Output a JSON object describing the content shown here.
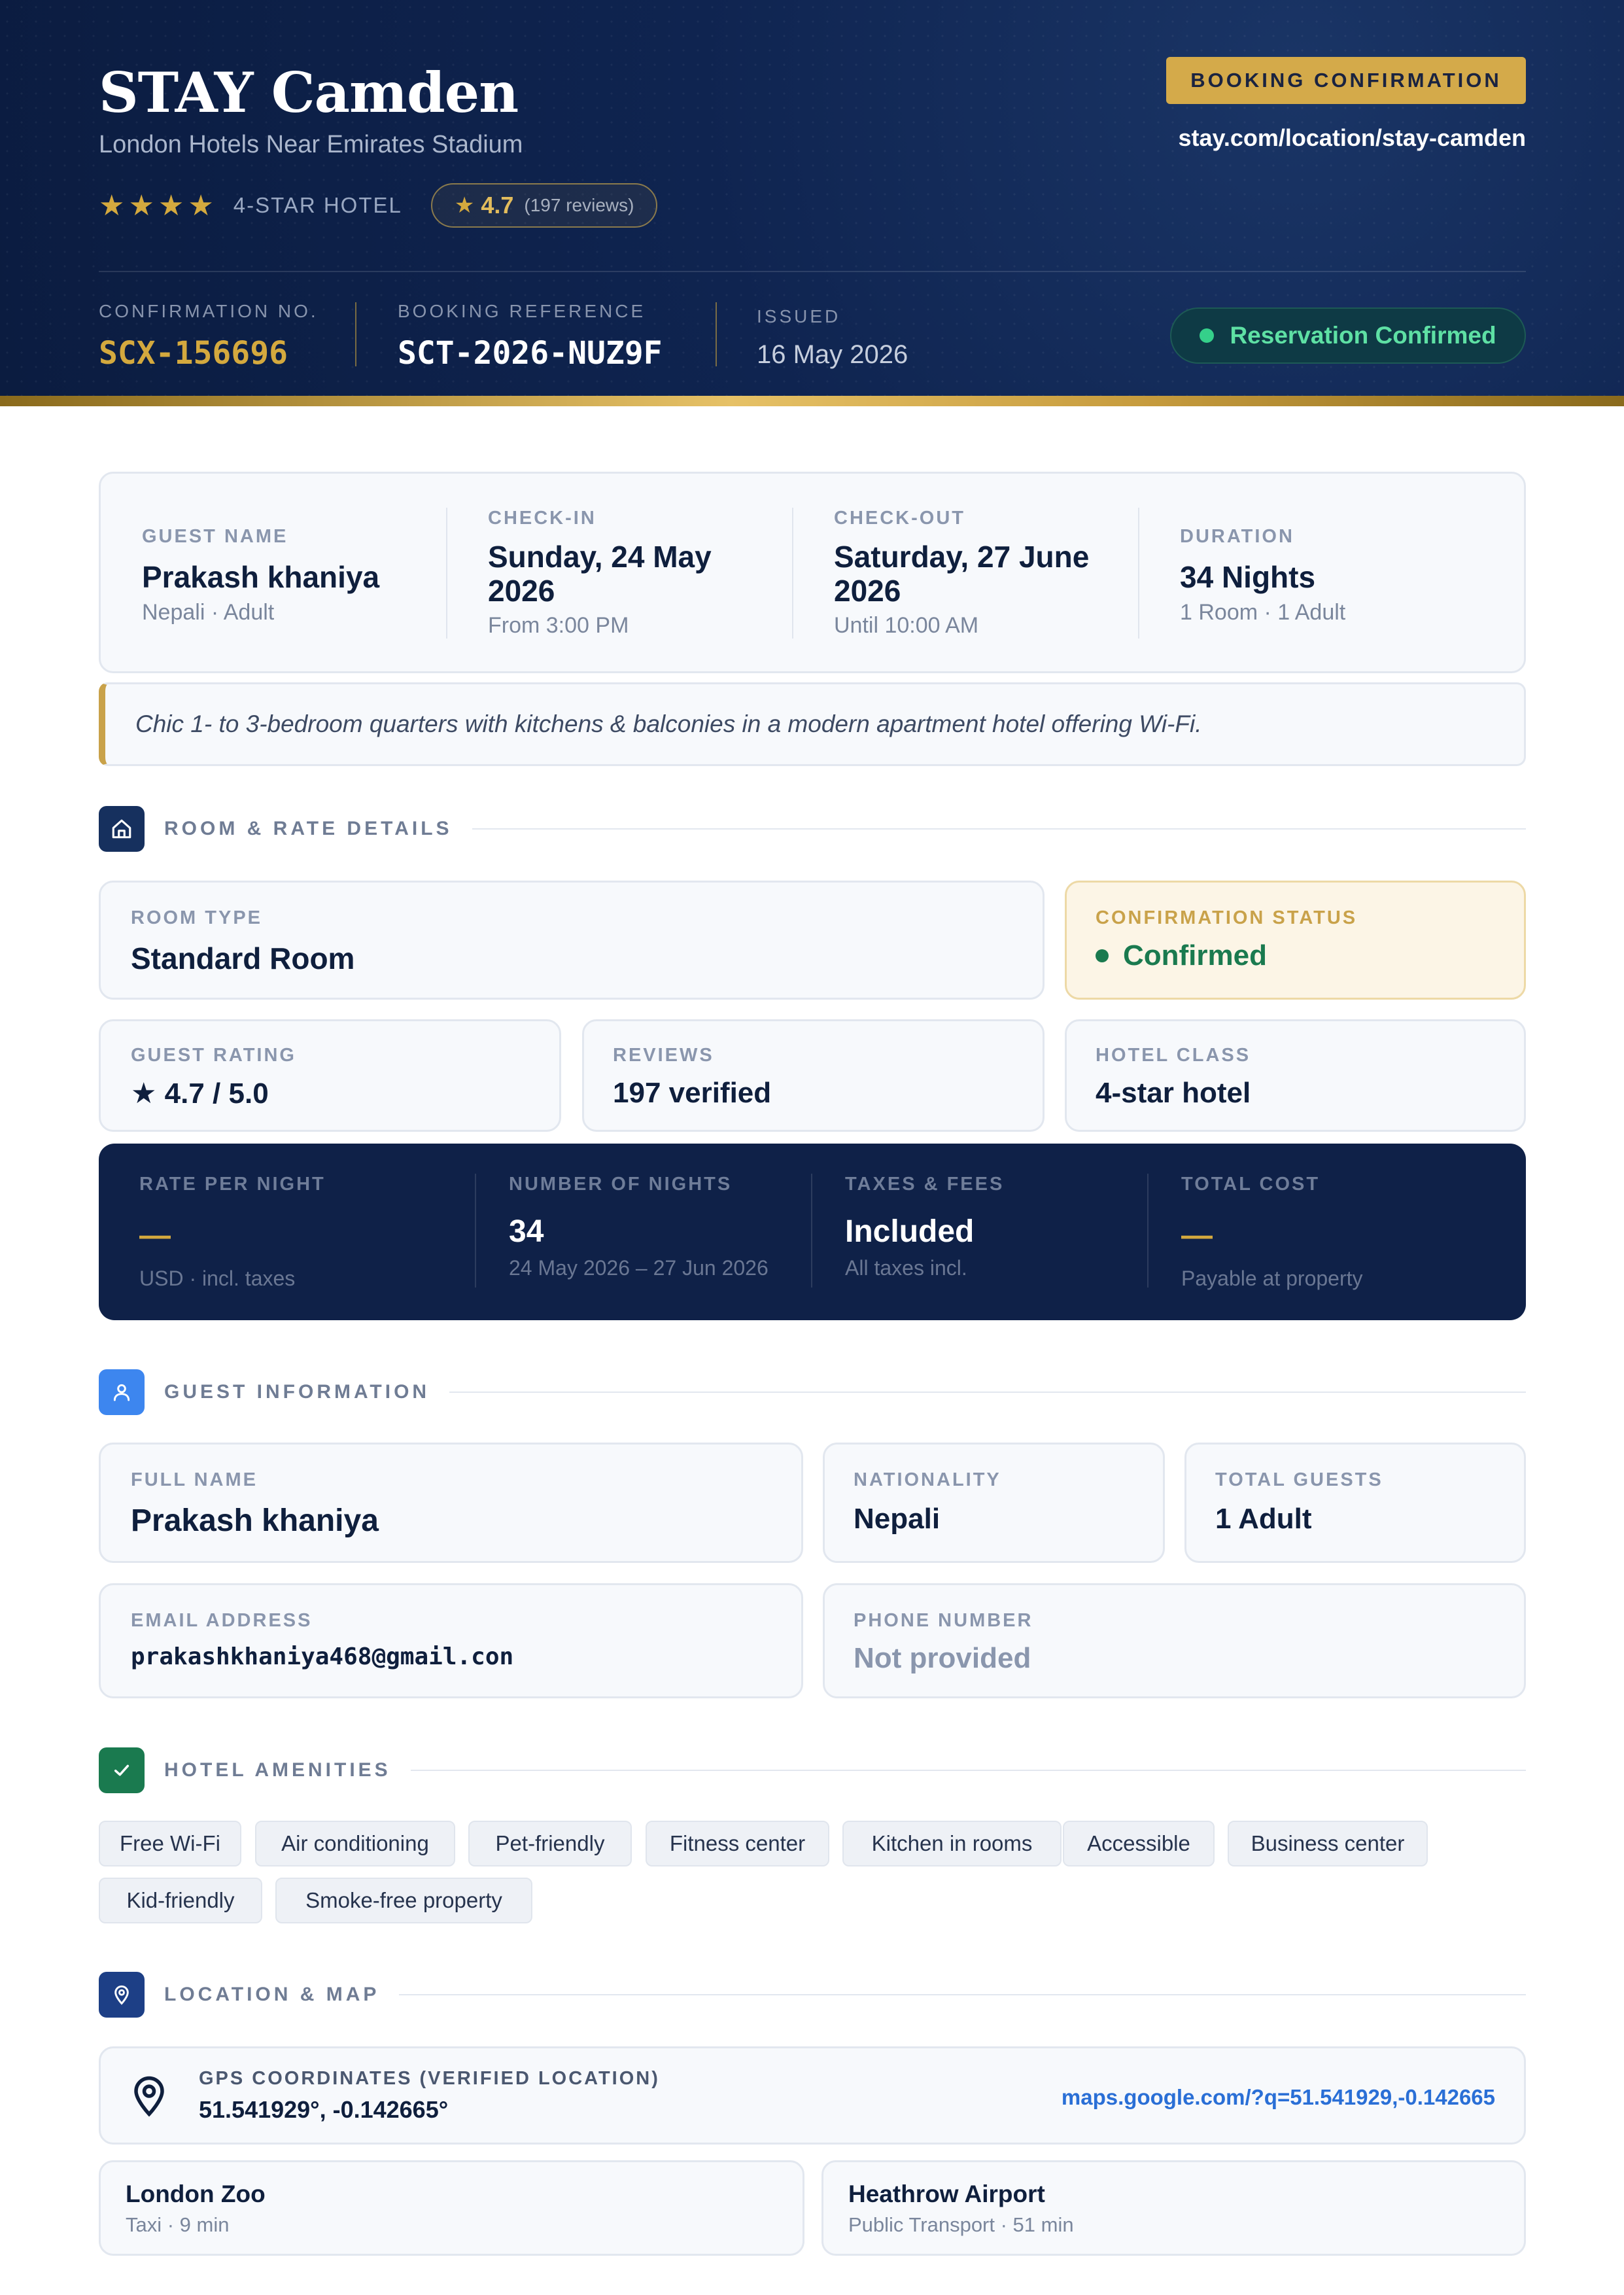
{
  "header": {
    "hotel_name": "STAY Camden",
    "subtitle": "London Hotels Near Emirates Stadium",
    "stars": "★★★★",
    "hotel_class": "4-STAR HOTEL",
    "rating_star": "★",
    "rating_value": "4.7",
    "rating_reviews": "(197 reviews)",
    "badge": "BOOKING CONFIRMATION",
    "url": "stay.com/location/stay-camden",
    "confirmation_label": "CONFIRMATION NO.",
    "confirmation_no": "SCX-156696",
    "booking_ref_label": "BOOKING REFERENCE",
    "booking_ref": "SCT-2026-NUZ9F",
    "issued_label": "ISSUED",
    "issued": "16 May 2026",
    "status": "Reservation Confirmed"
  },
  "summary": {
    "guest_label": "GUEST NAME",
    "guest_name": "Prakash khaniya",
    "guest_sub": "Nepali · Adult",
    "checkin_label": "CHECK-IN",
    "checkin_line1": "Sunday, 24 May",
    "checkin_line2": "2026",
    "checkin_sub": "From 3:00 PM",
    "checkout_label": "CHECK-OUT",
    "checkout_line1": "Saturday, 27 June",
    "checkout_line2": "2026",
    "checkout_sub": "Until 10:00 AM",
    "duration_label": "DURATION",
    "duration": "34 Nights",
    "duration_sub": "1 Room · 1 Adult"
  },
  "description": "Chic 1- to 3-bedroom quarters with kitchens & balconies in a modern apartment hotel offering Wi-Fi.",
  "room": {
    "section_title": "ROOM & RATE DETAILS",
    "room_type_label": "ROOM TYPE",
    "room_type": "Standard Room",
    "conf_status_label": "CONFIRMATION STATUS",
    "conf_status": "Confirmed",
    "guest_rating_label": "GUEST RATING",
    "guest_rating": "★ 4.7 / 5.0",
    "reviews_label": "REVIEWS",
    "reviews": "197 verified",
    "hotel_class_label": "HOTEL CLASS",
    "hotel_class": "4-star hotel"
  },
  "rates": {
    "rate_label": "RATE PER NIGHT",
    "rate_value": "—",
    "rate_sub": "USD · incl. taxes",
    "nights_label": "NUMBER OF NIGHTS",
    "nights_value": "34",
    "nights_sub": "24 May 2026 – 27 Jun 2026",
    "taxes_label": "TAXES & FEES",
    "taxes_value": "Included",
    "taxes_sub": "All taxes incl.",
    "total_label": "TOTAL COST",
    "total_value": "—",
    "total_sub": "Payable at property"
  },
  "guest": {
    "section_title": "GUEST INFORMATION",
    "full_name_label": "FULL NAME",
    "full_name": "Prakash khaniya",
    "nationality_label": "NATIONALITY",
    "nationality": "Nepali",
    "total_guests_label": "TOTAL GUESTS",
    "total_guests": "1 Adult",
    "email_label": "EMAIL ADDRESS",
    "email": "prakashkhaniya468@gmail.con",
    "phone_label": "PHONE NUMBER",
    "phone": "Not provided"
  },
  "amenities": {
    "section_title": "HOTEL AMENITIES",
    "items": [
      "Free Wi-Fi",
      "Air conditioning",
      "Pet-friendly",
      "Fitness center",
      "Kitchen in rooms",
      "Accessible",
      "Business center",
      "Kid-friendly",
      "Smoke-free property"
    ]
  },
  "location": {
    "section_title": "LOCATION & MAP",
    "gps_label": "GPS COORDINATES (VERIFIED LOCATION)",
    "gps": "51.541929°, -0.142665°",
    "map_link": "maps.google.com/?q=51.541929,-0.142665",
    "nearby": [
      {
        "name": "London Zoo",
        "detail": "Taxi · 9 min"
      },
      {
        "name": "Heathrow Airport",
        "detail": "Public Transport · 51 min"
      }
    ]
  },
  "colors": {
    "navy": "#0f2148",
    "gold": "#d4a93e",
    "green": "#1a7a4f",
    "link_blue": "#2a6fd6"
  },
  "icons": {
    "room": "home-icon",
    "guest": "user-icon",
    "amenities": "check-icon",
    "location": "map-pin-icon",
    "gps": "location-pin-icon"
  }
}
